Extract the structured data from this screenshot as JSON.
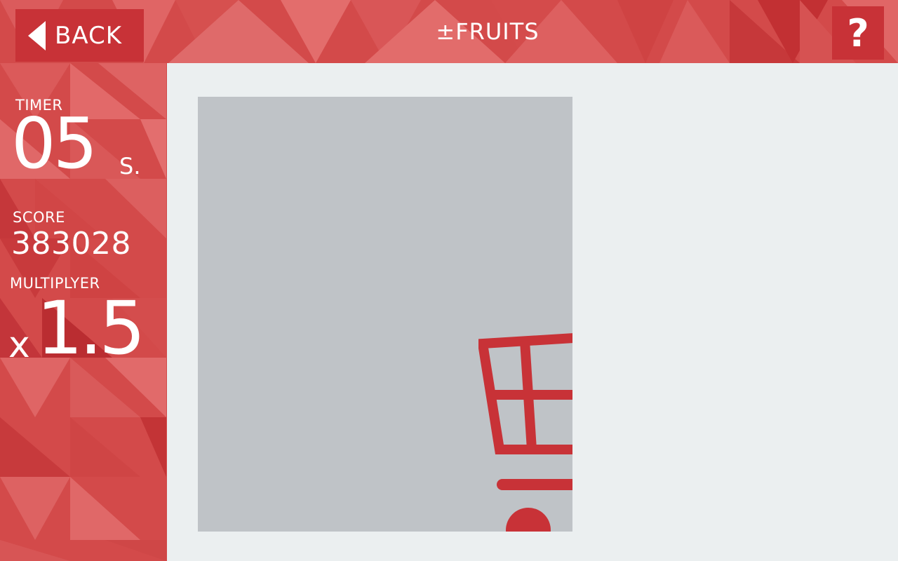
{
  "header": {
    "back_label": "BACK",
    "title": "±FRUITS",
    "help_label": "?"
  },
  "hud": {
    "timer_label": "TIMER",
    "timer_value": "05",
    "timer_unit": "S.",
    "score_label": "SCORE",
    "score_value": "383028",
    "multiplier_label": "MULTIPLYER",
    "multiplier_prefix": "x",
    "multiplier_value": "1.5"
  },
  "icons": {
    "back": "back-arrow-icon",
    "cart": "shopping-cart-icon"
  },
  "colors": {
    "brand_red": "#c83237",
    "panel_red": "#d34a4a",
    "play_bg": "#ebeff0",
    "board_bg": "#bfc3c7"
  }
}
